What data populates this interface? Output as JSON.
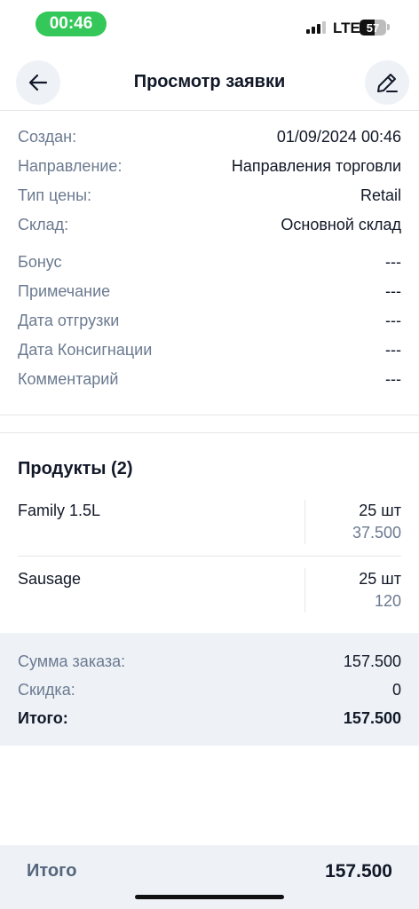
{
  "status_bar": {
    "time": "00:46",
    "network": "LTE",
    "battery": "57",
    "battery_level": 0.57,
    "signal_bars": 3
  },
  "header": {
    "title": "Просмотр заявки",
    "back_icon": "arrow-left-icon",
    "edit_icon": "pencil-icon"
  },
  "details": [
    {
      "label": "Создан:",
      "value": "01/09/2024 00:46"
    },
    {
      "label": "Направление:",
      "value": "Направления торговли"
    },
    {
      "label": "Тип цены:",
      "value": "Retail"
    },
    {
      "label": "Склад:",
      "value": "Основной склад"
    }
  ],
  "extra_details": [
    {
      "label": "Бонус",
      "value": "---"
    },
    {
      "label": "Примечание",
      "value": "---"
    },
    {
      "label": "Дата отгрузки",
      "value": "---"
    },
    {
      "label": "Дата Консигнации",
      "value": "---"
    },
    {
      "label": "Комментарий",
      "value": "---"
    }
  ],
  "products": {
    "title": "Продукты (2)",
    "items": [
      {
        "name": "Family 1.5L",
        "qty": "25 шт",
        "price": "37.500"
      },
      {
        "name": "Sausage",
        "qty": "25 шт",
        "price": "120"
      }
    ]
  },
  "summary": {
    "order_sum_label": "Сумма заказа:",
    "order_sum_value": "157.500",
    "discount_label": "Скидка:",
    "discount_value": "0",
    "total_label": "Итого:",
    "total_value": "157.500"
  },
  "footer": {
    "label": "Итого",
    "value": "157.500"
  },
  "colors": {
    "accent_green": "#34c759",
    "muted_text": "#6b7a90",
    "panel_bg": "#eef2f7"
  }
}
